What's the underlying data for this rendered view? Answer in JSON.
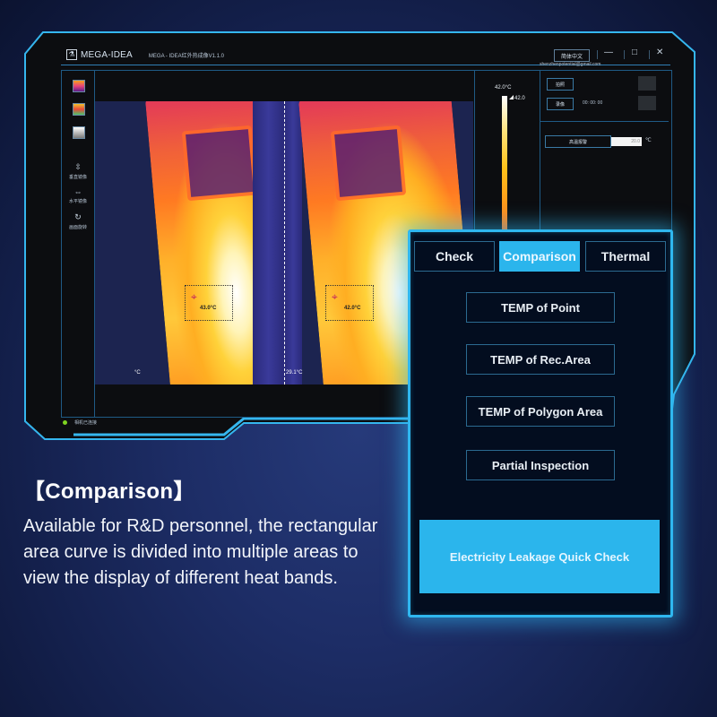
{
  "window": {
    "brand": "MEGA-IDEA",
    "title": "MEGA - IDEA红外热成像V1.1.0",
    "language_button": "简体中文",
    "controls": {
      "minimize": "—",
      "maximize": "□",
      "close": "✕"
    }
  },
  "toolbar": {
    "palettes": [
      {
        "name": "iron-palette",
        "colors": [
          "#f7a21b",
          "#e8437a",
          "#5a1d8c"
        ]
      },
      {
        "name": "rainbow-palette",
        "colors": [
          "#f2c12e",
          "#e84a3a",
          "#49c36a"
        ]
      },
      {
        "name": "grayscale-palette",
        "colors": [
          "#ffffff",
          "#7a7a7a"
        ]
      }
    ],
    "tools": [
      {
        "icon": "vertical-mirror-icon",
        "glyph": "⇳",
        "label": "垂直镜像"
      },
      {
        "icon": "horizontal-mirror-icon",
        "glyph": "⇔",
        "label": "水平镜像"
      },
      {
        "icon": "rotate-icon",
        "glyph": "↻",
        "label": "画面旋转"
      }
    ]
  },
  "viewer": {
    "left_roi_temp": "43.0°C",
    "right_roi_temp": "42.0°C",
    "left_min_temp": "°C",
    "right_min_temp": "29.1°C"
  },
  "scale": {
    "max_label": "42.0°C",
    "marker_value": "42.0"
  },
  "side_panel": {
    "email": "shenzhenpotential@gmail.com",
    "photo_button": "拍照",
    "record_button": "录像",
    "record_time": "00: 00: 00",
    "alarm_button": "高温报警",
    "alarm_value": "20.0",
    "alarm_unit": "℃"
  },
  "status": {
    "text": "相机已连接",
    "color": "#7ed321"
  },
  "panel": {
    "tabs": [
      {
        "label": "Check",
        "active": false
      },
      {
        "label": "Comparison",
        "active": true
      },
      {
        "label": "Thermal",
        "active": false
      }
    ],
    "buttons": [
      "TEMP of Point",
      "TEMP of Rec.Area",
      "TEMP of Polygon Area",
      "Partial Inspection"
    ],
    "primary_button": "Electricity Leakage Quick Check",
    "accent": "#2bb5ec"
  },
  "caption": {
    "title": "【Comparison】",
    "body": "Available for R&D personnel, the rectangular area curve is divided into multiple areas to view the display of different heat bands."
  }
}
